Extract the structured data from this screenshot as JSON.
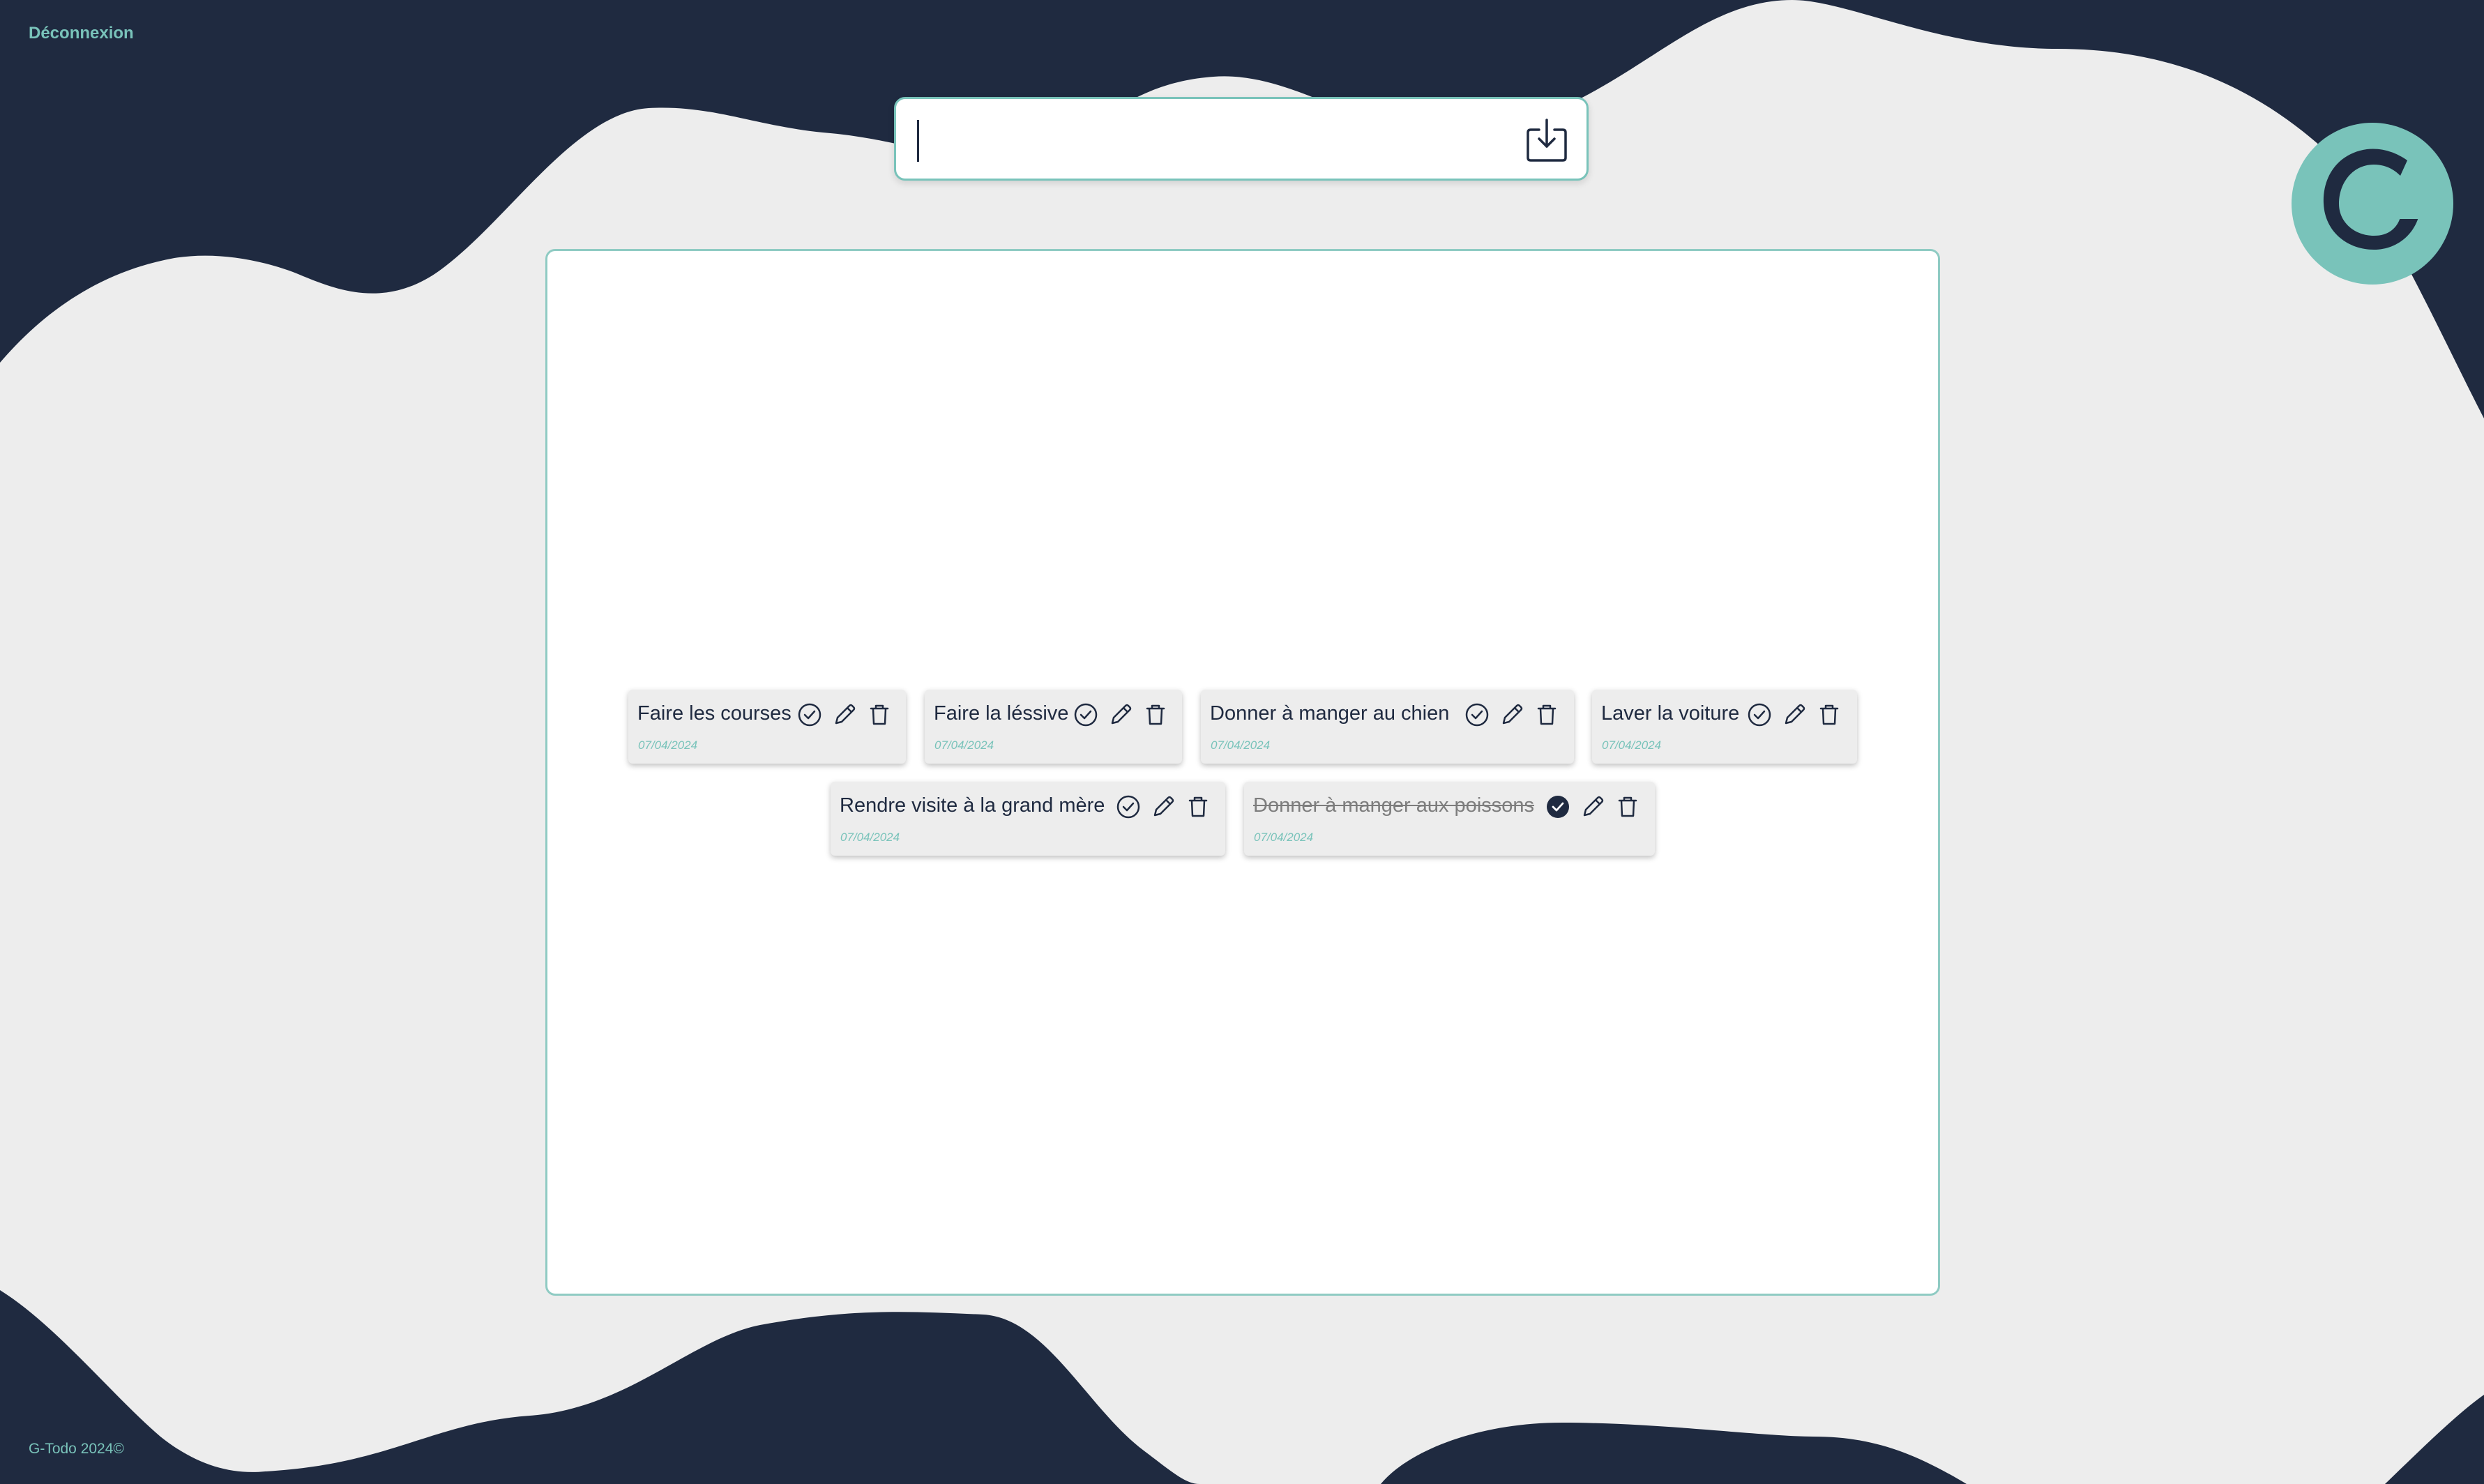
{
  "header": {
    "logout_label": "Déconnexion"
  },
  "footer": {
    "copyright": "G-Todo 2024©"
  },
  "input": {
    "value": "",
    "placeholder": ""
  },
  "tasks": [
    {
      "title": "Faire les courses",
      "date": "07/04/2024",
      "done": false
    },
    {
      "title": "Faire la léssive",
      "date": "07/04/2024",
      "done": false
    },
    {
      "title": "Donner à manger au chien",
      "date": "07/04/2024",
      "done": false
    },
    {
      "title": "Laver la voiture",
      "date": "07/04/2024",
      "done": false
    },
    {
      "title": "Rendre visite à la grand mère",
      "date": "07/04/2024",
      "done": false
    },
    {
      "title": "Donner à manger aux poissons",
      "date": "07/04/2024",
      "done": true
    }
  ],
  "colors": {
    "navy": "#1f2a40",
    "teal": "#79c3ba",
    "light_gray": "#ededed",
    "white": "#ffffff"
  },
  "icons": {
    "save": "download-tray-icon",
    "complete": "check-circle-icon",
    "edit": "pencil-icon",
    "delete": "trash-icon",
    "logo": "g-logo"
  }
}
